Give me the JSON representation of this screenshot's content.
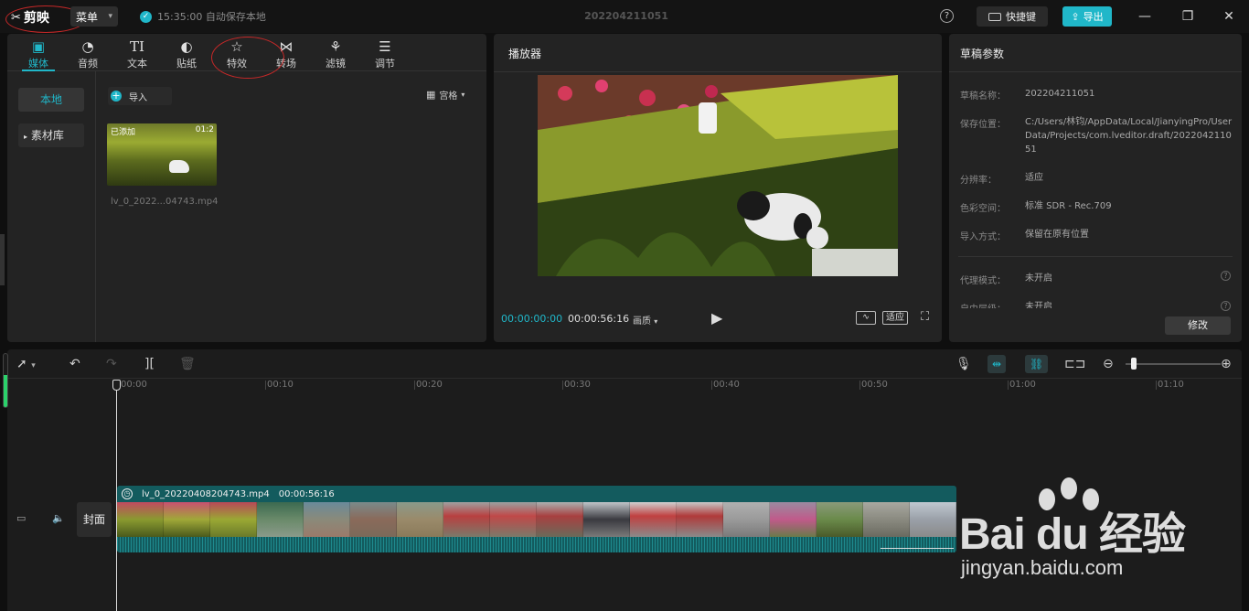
{
  "titlebar": {
    "app_name": "剪映",
    "menu_label": "菜单",
    "autosave_text": "15:35:00 自动保存本地",
    "project_title": "202204211051",
    "shortcut_label": "快捷键",
    "export_label": "导出"
  },
  "media_panel": {
    "tabs": [
      {
        "label": "媒体",
        "icon": "media-icon"
      },
      {
        "label": "音频",
        "icon": "audio-icon"
      },
      {
        "label": "文本",
        "icon": "text-icon"
      },
      {
        "label": "贴纸",
        "icon": "sticker-icon"
      },
      {
        "label": "特效",
        "icon": "effects-icon"
      },
      {
        "label": "转场",
        "icon": "transition-icon"
      },
      {
        "label": "滤镜",
        "icon": "filter-icon"
      },
      {
        "label": "调节",
        "icon": "adjust-icon"
      }
    ],
    "active_tab": "媒体",
    "nav_local": "本地",
    "nav_library": "素材库",
    "import_label": "导入",
    "sort_label": "宫格",
    "clip": {
      "badge": "已添加",
      "duration": "01:2",
      "filename": "lv_0_2022...04743.mp4"
    }
  },
  "player": {
    "title": "播放器",
    "current_time": "00:00:00:00",
    "total_time": "00:00:56:16",
    "quality_label": "画质",
    "fit_label": "适应"
  },
  "params": {
    "title": "草稿参数",
    "rows": [
      {
        "label": "草稿名称：",
        "value": "202204211051"
      },
      {
        "label": "保存位置：",
        "value": "C:/Users/林钧/AppData/Local/JianyingPro/User Data/Projects/com.lveditor.draft/202204211051"
      },
      {
        "label": "分辨率：",
        "value": "适应"
      },
      {
        "label": "色彩空间：",
        "value": "标准 SDR - Rec.709"
      },
      {
        "label": "导入方式：",
        "value": "保留在原有位置"
      },
      {
        "label": "代理模式：",
        "value": "未开启"
      },
      {
        "label": "自由层级：",
        "value": "未开启"
      }
    ],
    "edit_label": "修改"
  },
  "timeline": {
    "ticks": [
      "00:00",
      "00:10",
      "00:20",
      "00:30",
      "00:40",
      "00:50",
      "01:00",
      "01:10"
    ],
    "cover_label": "封面",
    "clip_name": "lv_0_20220408204743.mp4",
    "clip_duration": "00:00:56:16"
  },
  "watermark": {
    "brand": "Bai du 经验",
    "url": "jingyan.baidu.com"
  },
  "colors": {
    "accent": "#20b7c9",
    "clip": "#135b5e",
    "annotation": "#c62828"
  }
}
